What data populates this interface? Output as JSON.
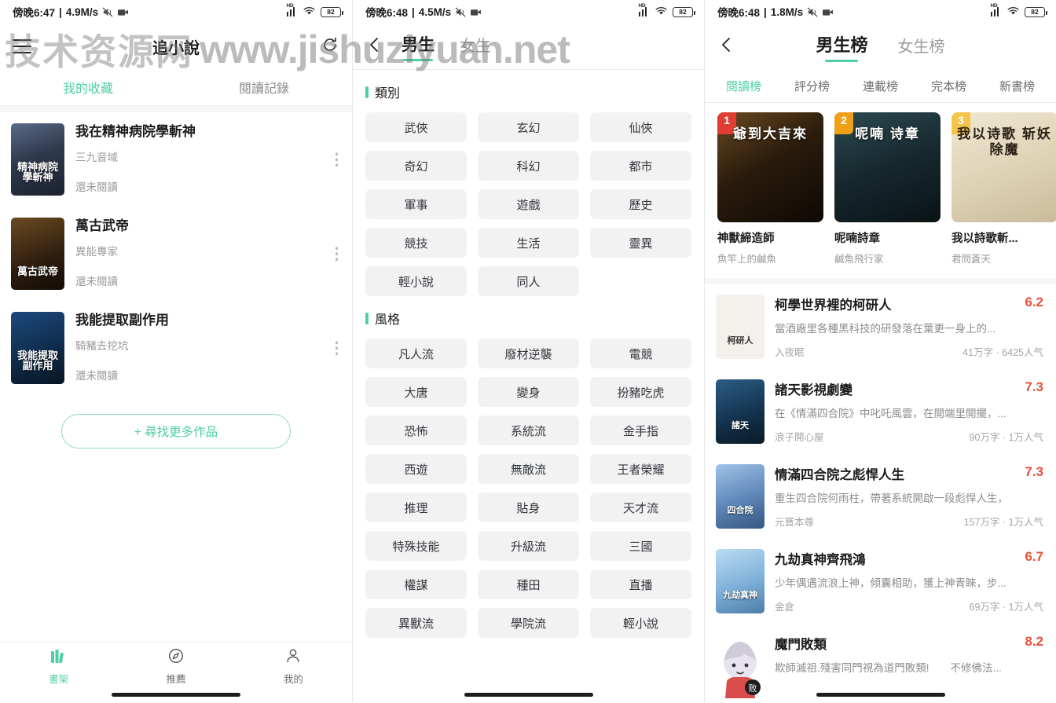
{
  "watermark": {
    "cn": "技术资源网",
    "url": "www.jishuziyuan.net"
  },
  "panel1": {
    "statusbar": {
      "time": "傍晚6:47",
      "speed": "4.9M/s",
      "battery": "82",
      "network_label": "HD"
    },
    "header": {
      "title": "追小說",
      "menu_icon": "hamburger-icon",
      "refresh_icon": "refresh-icon"
    },
    "tabs": [
      {
        "label": "我的收藏",
        "active": true
      },
      {
        "label": "閱讀記錄",
        "active": false
      }
    ],
    "books": [
      {
        "title": "我在精神病院學斬神",
        "author": "三九音域",
        "status": "還未閱讀",
        "cover_text": "精神病院\n學斬神"
      },
      {
        "title": "萬古武帝",
        "author": "異能專家",
        "status": "還未閱讀",
        "cover_text": "萬古武帝"
      },
      {
        "title": "我能提取副作用",
        "author": "騎豬去挖坑",
        "status": "還未閱讀",
        "cover_text": "我能提取\n副作用"
      }
    ],
    "find_more": "+ 尋找更多作品",
    "tabbar": [
      {
        "label": "書架",
        "icon": "bookshelf-icon",
        "active": true
      },
      {
        "label": "推薦",
        "icon": "compass-icon",
        "active": false
      },
      {
        "label": "我的",
        "icon": "person-icon",
        "active": false
      }
    ]
  },
  "panel2": {
    "statusbar": {
      "time": "傍晚6:48",
      "speed": "4.5M/s",
      "battery": "82",
      "network_label": "HD"
    },
    "header": {
      "back_icon": "chevron-left-icon"
    },
    "tabs": [
      {
        "label": "男生",
        "active": true
      },
      {
        "label": "女生",
        "active": false
      }
    ],
    "sections": [
      {
        "title": "類別",
        "tags": [
          "武俠",
          "玄幻",
          "仙俠",
          "奇幻",
          "科幻",
          "都市",
          "軍事",
          "遊戲",
          "歷史",
          "競技",
          "生活",
          "靈異",
          "輕小說",
          "同人"
        ]
      },
      {
        "title": "風格",
        "tags": [
          "凡人流",
          "廢材逆襲",
          "電競",
          "大唐",
          "變身",
          "扮豬吃虎",
          "恐怖",
          "系統流",
          "金手指",
          "西遊",
          "無敵流",
          "王者榮耀",
          "推理",
          "貼身",
          "天才流",
          "特殊技能",
          "升級流",
          "三國",
          "權謀",
          "種田",
          "直播",
          "異獸流",
          "學院流",
          "輕小說"
        ]
      }
    ]
  },
  "panel3": {
    "statusbar": {
      "time": "傍晚6:48",
      "speed": "1.8M/s",
      "battery": "82",
      "network_label": "HD"
    },
    "header": {
      "back_icon": "chevron-left-icon"
    },
    "tabs": [
      {
        "label": "男生榜",
        "active": true
      },
      {
        "label": "女生榜",
        "active": false
      }
    ],
    "subtabs": [
      {
        "label": "閱讀榜",
        "active": true
      },
      {
        "label": "評分榜",
        "active": false
      },
      {
        "label": "連載榜",
        "active": false
      },
      {
        "label": "完本榜",
        "active": false
      },
      {
        "label": "新書榜",
        "active": false
      }
    ],
    "top3": [
      {
        "rank": "1",
        "title": "神獸締造師",
        "author": "魚竿上的鹹魚",
        "cover_text": "爺到大吉來"
      },
      {
        "rank": "2",
        "title": "呢喃詩章",
        "author": "鹹魚飛行家",
        "cover_text": "呢喃 诗章"
      },
      {
        "rank": "3",
        "title": "我以詩歌斬...",
        "author": "君問蒼天",
        "cover_text": "我以诗歌\n斩妖除魔"
      }
    ],
    "ranking": [
      {
        "title": "柯學世界裡的柯研人",
        "score": "6.2",
        "desc": "當酒廠里各種黑科技的研發落在葉更一身上的...",
        "author": "入夜眠",
        "stats": "41万字 · 6425人气",
        "cover_text": "柯研人"
      },
      {
        "title": "諸天影視劇變",
        "score": "7.3",
        "desc": "在《情滿四合院》中叱吒風雲，在開端里開擺，...",
        "author": "浪子開心屋",
        "stats": "90万字 · 1万人气",
        "cover_text": "諸天"
      },
      {
        "title": "情滿四合院之彪悍人生",
        "score": "7.3",
        "desc": "重生四合院何雨柱，帶著系統開啟一段彪悍人生，",
        "author": "元寶本尊",
        "stats": "157万字 · 1万人气",
        "cover_text": "四合院"
      },
      {
        "title": "九劫真神齊飛鴻",
        "score": "6.7",
        "desc": "少年偶遇流浪上神，傾囊相助，獲上神青睞，步...",
        "author": "金倉",
        "stats": "69万字 · 1万人气",
        "cover_text": "九劫真神"
      },
      {
        "title": "魔門敗類",
        "score": "8.2",
        "desc": "欺師滅祖.殘害同門視為道門敗類!　　不修佛法...",
        "author": "",
        "stats": "",
        "cover_text": ""
      }
    ]
  },
  "colors": {
    "accent": "#4ecfa0",
    "score": "#e8503a",
    "rank1": "#e03e32",
    "rank2": "#f0a017",
    "rank3": "#f3c44a"
  }
}
